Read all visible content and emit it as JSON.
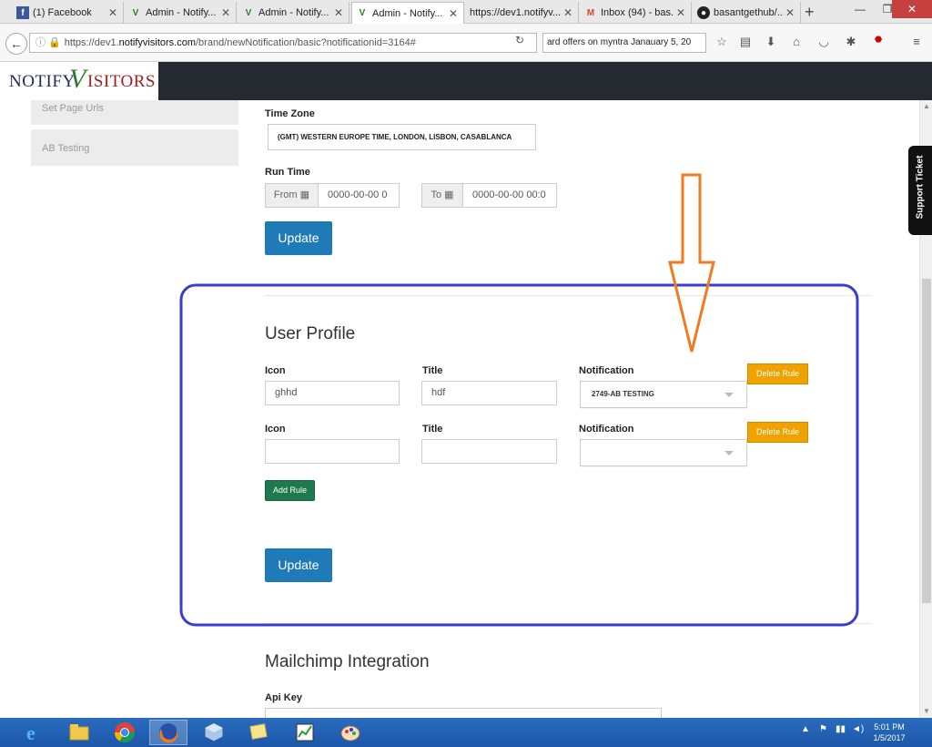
{
  "browser": {
    "tabs": [
      {
        "label": "(1) Facebook",
        "icon": "facebook-icon"
      },
      {
        "label": "Admin - Notify...",
        "icon": "notifyvisitors-icon"
      },
      {
        "label": "Admin - Notify...",
        "icon": "notifyvisitors-icon"
      },
      {
        "label": "Admin - Notify...",
        "icon": "notifyvisitors-icon",
        "active": true
      },
      {
        "label": "https://dev1.notifyv...",
        "icon": "blank-page-icon"
      },
      {
        "label": "Inbox (94) - bas...",
        "icon": "gmail-icon"
      },
      {
        "label": "basantgethub/...",
        "icon": "github-icon"
      }
    ],
    "url_prefix": "https://dev1.",
    "url_domain": "notifyvisitors.com",
    "url_path": "/brand/newNotification/basic?notificationid=3164#",
    "search_text": "ard offers on myntra Janauary 5, 20"
  },
  "site": {
    "logo_part1": "NOTIFY",
    "logo_v": "V",
    "logo_part2": "ISITORS"
  },
  "sidebar": {
    "items": [
      {
        "label": "Set Page Urls"
      },
      {
        "label": "AB Testing"
      }
    ]
  },
  "schedule": {
    "timezone_label": "Time Zone",
    "timezone_value": "(GMT) WESTERN EUROPE TIME, LONDON, LISBON, CASABLANCA",
    "runtime_label": "Run Time",
    "from_label": "From",
    "from_value": "0000-00-00 0",
    "to_label": "To",
    "to_value": "0000-00-00 00:0",
    "update_label": "Update"
  },
  "user_profile": {
    "heading": "User Profile",
    "rows": [
      {
        "icon_label": "Icon",
        "icon_value": "ghhd",
        "title_label": "Title",
        "title_value": "hdf",
        "notification_label": "Notification",
        "notification_value": "2749-AB TESTING",
        "delete_label": "Delete Rule"
      },
      {
        "icon_label": "Icon",
        "icon_value": "",
        "title_label": "Title",
        "title_value": "",
        "notification_label": "Notification",
        "notification_value": "",
        "delete_label": "Delete Rule"
      }
    ],
    "add_rule_label": "Add Rule",
    "update_label": "Update"
  },
  "mailchimp": {
    "heading": "Mailchimp Integration",
    "api_key_label": "Api Key",
    "api_key_value": ""
  },
  "support_label": "Support Ticket",
  "taskbar": {
    "apps": [
      "internet-explorer-icon",
      "file-explorer-icon",
      "chrome-icon",
      "firefox-icon",
      "virtualbox-icon",
      "sticky-notes-icon",
      "task-manager-icon",
      "paint-icon"
    ],
    "time": "5:01 PM",
    "date": "1/5/2017"
  },
  "colors": {
    "update_button": "#1f7ab8",
    "delete_button": "#f0a200",
    "add_button": "#1e7a4e",
    "annotation_box": "#3a3ecf",
    "annotation_arrow": "#f07c22",
    "header_bg": "#252a31"
  }
}
